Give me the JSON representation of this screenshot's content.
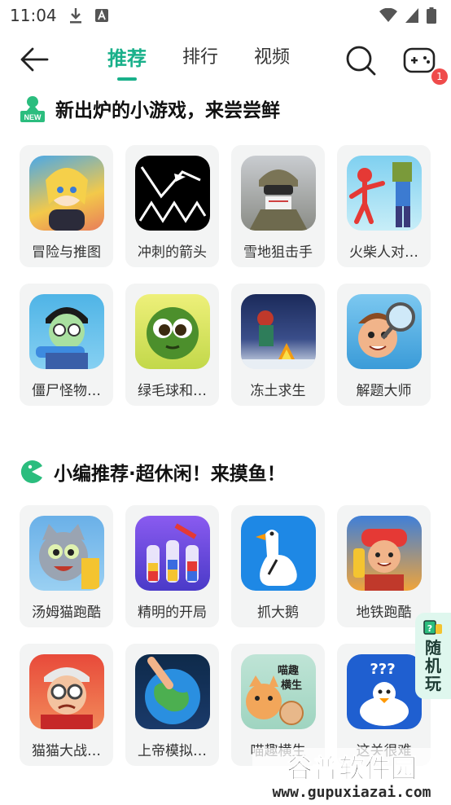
{
  "status_bar": {
    "time": "11:04"
  },
  "nav": {
    "tabs": [
      {
        "label": "推荐"
      },
      {
        "label": "排行"
      },
      {
        "label": "视频"
      }
    ],
    "badge_count": "1"
  },
  "section1": {
    "title": "新出炉的小游戏，来尝尝鲜",
    "icon_label": "NEW",
    "games": [
      {
        "name": "冒险与推图"
      },
      {
        "name": "冲刺的箭头"
      },
      {
        "name": "雪地狙击手"
      },
      {
        "name": "火柴人对…"
      },
      {
        "name": "僵尸怪物…"
      },
      {
        "name": "绿毛球和…"
      },
      {
        "name": "冻土求生"
      },
      {
        "name": "解题大师"
      }
    ]
  },
  "section2": {
    "title": "小编推荐·超休闲！来摸鱼！",
    "games": [
      {
        "name": "汤姆猫跑酷"
      },
      {
        "name": "精明的开局"
      },
      {
        "name": "抓大鹅"
      },
      {
        "name": "地铁跑酷"
      },
      {
        "name": "猫猫大战…"
      },
      {
        "name": "上帝模拟…"
      },
      {
        "name": "喵趣横生"
      },
      {
        "name": "这关很难"
      }
    ]
  },
  "random_button": {
    "label": "随机玩"
  },
  "watermark": {
    "text": "谷普软件园",
    "url": "www.gupuxiazai.com"
  },
  "colors": {
    "accent": "#19b08a",
    "badge": "#ef4b4b"
  }
}
